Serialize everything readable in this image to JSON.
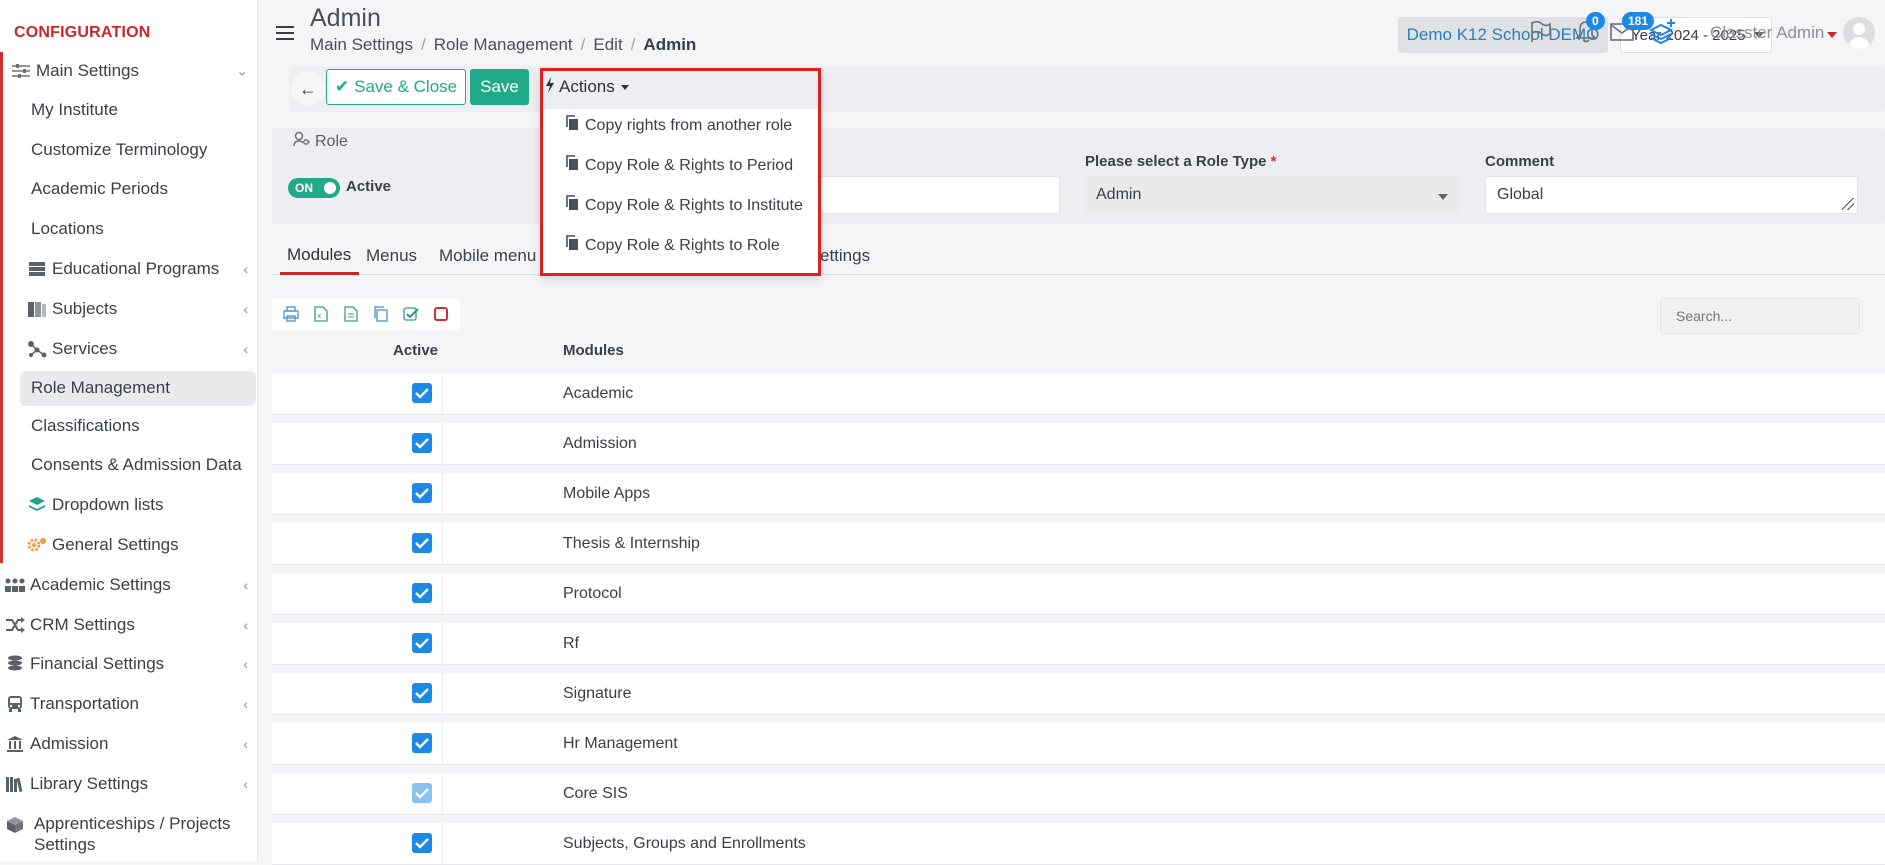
{
  "sidebar": {
    "title": "CONFIGURATION",
    "items": [
      {
        "label": "Main Settings",
        "icon": "sliders-icon"
      },
      {
        "label": "My Institute"
      },
      {
        "label": "Customize Terminology"
      },
      {
        "label": "Academic Periods"
      },
      {
        "label": "Locations"
      },
      {
        "label": "Educational Programs",
        "icon": "server-icon"
      },
      {
        "label": "Subjects",
        "icon": "books-icon"
      },
      {
        "label": "Services",
        "icon": "nodes-icon"
      },
      {
        "label": "Role Management"
      },
      {
        "label": "Classifications"
      },
      {
        "label": "Consents & Admission Data"
      },
      {
        "label": "Dropdown lists",
        "icon": "layers-icon"
      },
      {
        "label": "General Settings",
        "icon": "gears-icon"
      },
      {
        "label": "Academic Settings",
        "icon": "group-icon"
      },
      {
        "label": "CRM Settings",
        "icon": "shuffle-icon"
      },
      {
        "label": "Financial Settings",
        "icon": "coins-icon"
      },
      {
        "label": "Transportation",
        "icon": "bus-icon"
      },
      {
        "label": "Admission",
        "icon": "institution-icon"
      },
      {
        "label": "Library Settings",
        "icon": "library-icon"
      },
      {
        "label": "Apprenticeships / Projects Settings",
        "icon": "box-icon"
      }
    ]
  },
  "header": {
    "title": "Admin",
    "breadcrumb": [
      "Main Settings",
      "Role Management",
      "Edit",
      "Admin"
    ],
    "school": "Demo K12 School DEMO",
    "year": "Year 2024 - 2025",
    "notifications": "0",
    "messages": "181",
    "user": "Classter Admin"
  },
  "toolbar": {
    "save_close": "Save & Close",
    "save": "Save",
    "actions": "Actions"
  },
  "actions_menu": [
    "Copy rights from another role",
    "Copy Role & Rights to Period",
    "Copy Role & Rights to Institute",
    "Copy Role & Rights to Role"
  ],
  "role": {
    "section_label": "Role",
    "toggle": "ON",
    "status": "Active",
    "role_type_label": "Please select a Role Type",
    "role_type_required": "*",
    "role_type_value": "Admin",
    "comment_label": "Comment",
    "comment_value": "Global"
  },
  "tabs": [
    "Modules",
    "Menus",
    "Mobile menu",
    "ettings"
  ],
  "table": {
    "search_placeholder": "Search...",
    "col_active": "Active",
    "col_modules": "Modules",
    "rows": [
      {
        "module": "Academic",
        "active": true
      },
      {
        "module": "Admission",
        "active": true
      },
      {
        "module": "Mobile Apps",
        "active": true
      },
      {
        "module": "Thesis & Internship",
        "active": true
      },
      {
        "module": "Protocol",
        "active": true
      },
      {
        "module": "Rf",
        "active": true
      },
      {
        "module": "Signature",
        "active": true
      },
      {
        "module": "Hr Management",
        "active": true
      },
      {
        "module": "Core SIS",
        "active": true
      },
      {
        "module": "Subjects, Groups and Enrollments",
        "active": true
      }
    ]
  },
  "colors": {
    "accent_red": "#c62828",
    "success_green": "#22a98a",
    "primary_blue": "#1e88e5",
    "highlight_box": "#e02020"
  }
}
